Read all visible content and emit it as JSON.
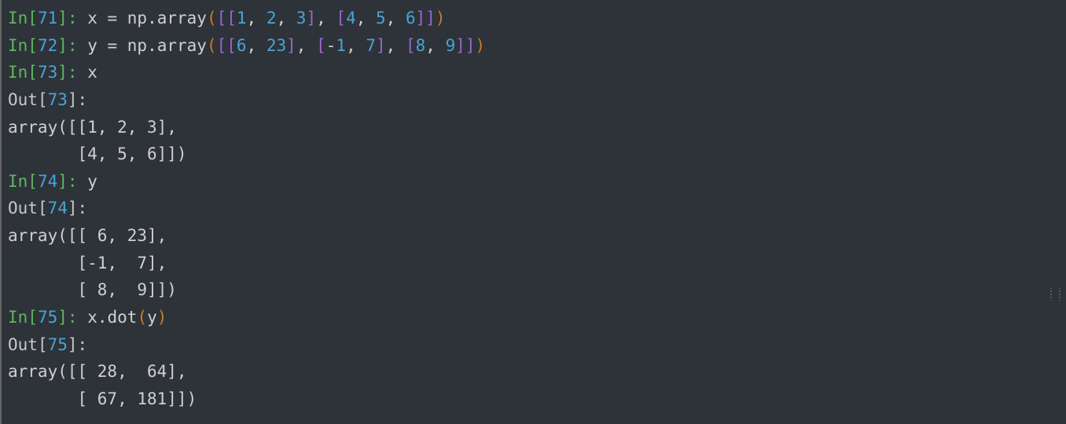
{
  "lines": {
    "l1": {
      "in_label": "In",
      "lbr": "[",
      "num": "71",
      "rbr": "]",
      "colon": ":",
      "sp": " ",
      "c1": "x = np.array",
      "p1": "(",
      "b1": "[[",
      "n1": "1",
      "c2": ", ",
      "n2": "2",
      "c3": ", ",
      "n3": "3",
      "b2": "]",
      "c4": ", ",
      "b3": "[",
      "n4": "4",
      "c5": ", ",
      "n5": "5",
      "c6": ", ",
      "n6": "6",
      "b4": "]]",
      "p2": ")"
    },
    "l2": {
      "in_label": "In",
      "lbr": "[",
      "num": "72",
      "rbr": "]",
      "colon": ":",
      "sp": " ",
      "c1": "y = np.array",
      "p1": "(",
      "b1": "[[",
      "n1": "6",
      "c2": ", ",
      "n2": "23",
      "b2": "]",
      "c3": ", ",
      "b3": "[",
      "m1": "-",
      "n3": "1",
      "c4": ", ",
      "n4": "7",
      "b4": "]",
      "c5": ", ",
      "b5": "[",
      "n5": "8",
      "c6": ", ",
      "n6": "9",
      "b6": "]]",
      "p2": ")"
    },
    "l3": {
      "in_label": "In",
      "lbr": "[",
      "num": "73",
      "rbr": "]",
      "colon": ":",
      "sp": " ",
      "c1": "x"
    },
    "l4": {
      "out_label": "Out",
      "lbr": "[",
      "num": "73",
      "rbr": "]",
      "colon": ":"
    },
    "l5": {
      "text": "array([[1, 2, 3],"
    },
    "l6": {
      "text": "       [4, 5, 6]])"
    },
    "l7": {
      "in_label": "In",
      "lbr": "[",
      "num": "74",
      "rbr": "]",
      "colon": ":",
      "sp": " ",
      "c1": "y"
    },
    "l8": {
      "out_label": "Out",
      "lbr": "[",
      "num": "74",
      "rbr": "]",
      "colon": ":"
    },
    "l9": {
      "text": "array([[ 6, 23],"
    },
    "l10": {
      "text": "       [-1,  7],"
    },
    "l11": {
      "text": "       [ 8,  9]])"
    },
    "l12": {
      "in_label": "In",
      "lbr": "[",
      "num": "75",
      "rbr": "]",
      "colon": ":",
      "sp": " ",
      "c1": "x.dot",
      "p1": "(",
      "c2": "y",
      "p2": ")"
    },
    "l13": {
      "out_label": "Out",
      "lbr": "[",
      "num": "75",
      "rbr": "]",
      "colon": ":"
    },
    "l14": {
      "text": "array([[ 28,  64],"
    },
    "l15": {
      "text": "       [ 67, 181]])"
    }
  }
}
